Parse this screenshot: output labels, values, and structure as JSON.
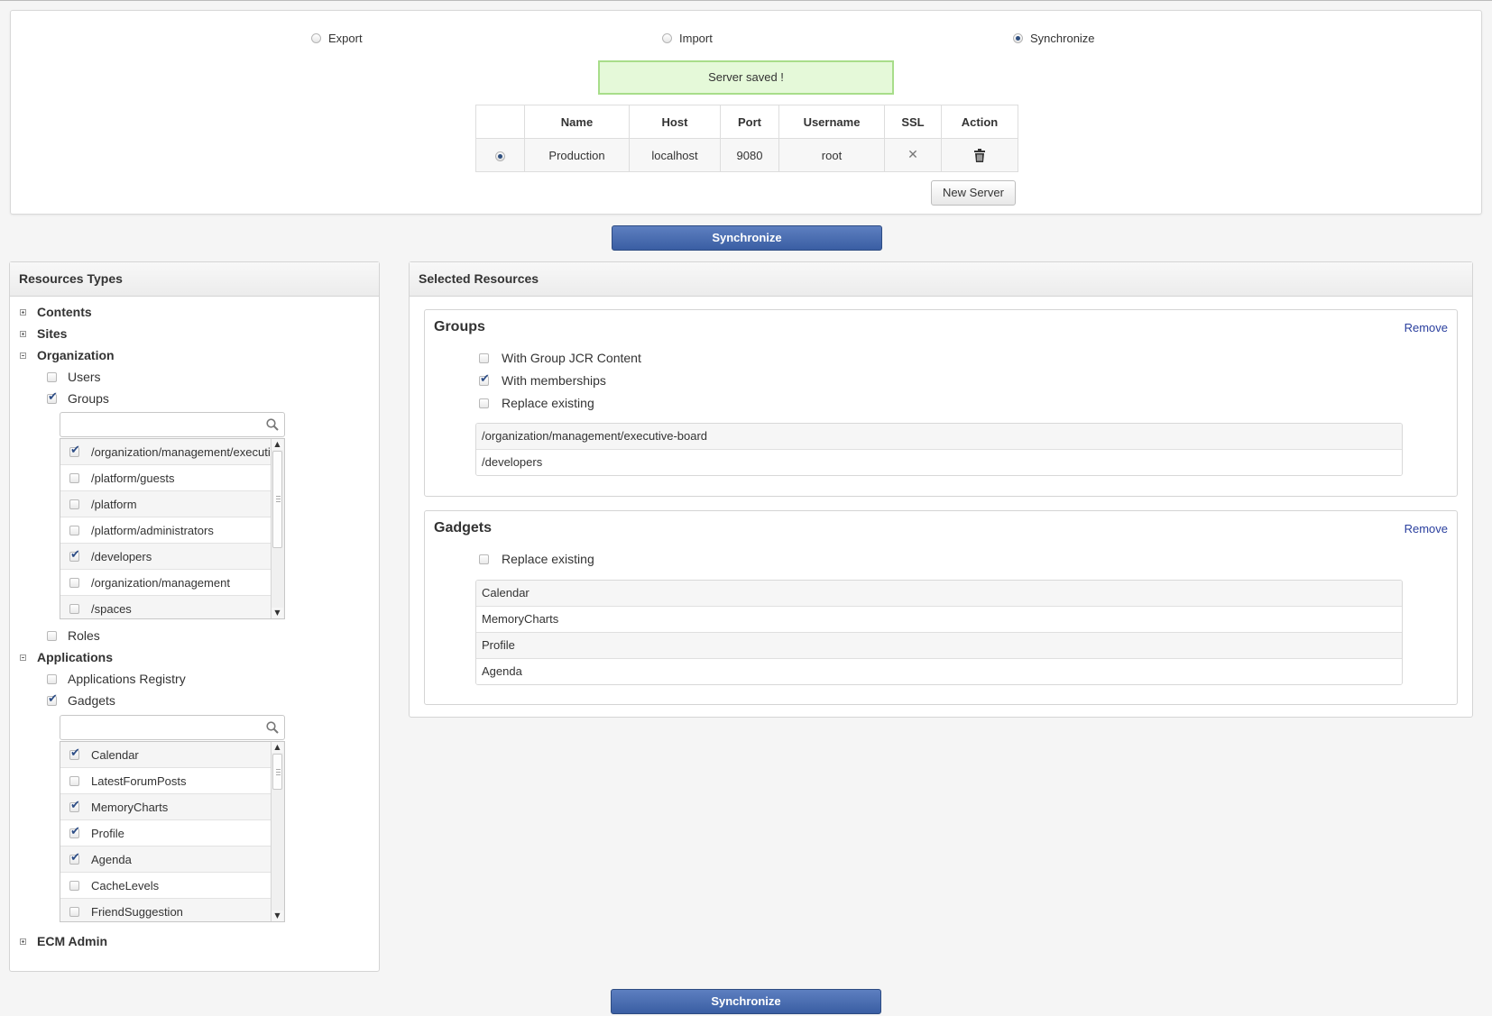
{
  "modes": [
    {
      "label": "Export",
      "selected": false
    },
    {
      "label": "Import",
      "selected": false
    },
    {
      "label": "Synchronize",
      "selected": true
    }
  ],
  "message": "Server saved !",
  "servers": {
    "headers": [
      "",
      "Name",
      "Host",
      "Port",
      "Username",
      "SSL",
      "Action"
    ],
    "rows": [
      {
        "name": "Production",
        "host": "localhost",
        "port": "9080",
        "username": "root",
        "ssl": "✕"
      }
    ]
  },
  "new_server_label": "New Server",
  "sync_label": "Synchronize",
  "resource_types": {
    "title": "Resources Types",
    "contents": "Contents",
    "sites": "Sites",
    "organization": "Organization",
    "users": "Users",
    "groups": "Groups",
    "roles": "Roles",
    "applications": "Applications",
    "applications_registry": "Applications Registry",
    "gadgets": "Gadgets",
    "ecm_admin": "ECM Admin",
    "group_search_placeholder": "",
    "gadget_search_placeholder": "",
    "group_list": [
      {
        "label": "/organization/management/executi",
        "checked": true
      },
      {
        "label": "/platform/guests",
        "checked": false
      },
      {
        "label": "/platform",
        "checked": false
      },
      {
        "label": "/platform/administrators",
        "checked": false
      },
      {
        "label": "/developers",
        "checked": true
      },
      {
        "label": "/organization/management",
        "checked": false
      },
      {
        "label": "/spaces",
        "checked": false
      }
    ],
    "gadget_list": [
      {
        "label": "Calendar",
        "checked": true
      },
      {
        "label": "LatestForumPosts",
        "checked": false
      },
      {
        "label": "MemoryCharts",
        "checked": true
      },
      {
        "label": "Profile",
        "checked": true
      },
      {
        "label": "Agenda",
        "checked": true
      },
      {
        "label": "CacheLevels",
        "checked": false
      },
      {
        "label": "FriendSuggestion",
        "checked": false
      }
    ]
  },
  "selected_resources": {
    "title": "Selected Resources",
    "groups": {
      "title": "Groups",
      "remove": "Remove",
      "options": [
        {
          "label": "With Group JCR Content",
          "checked": false
        },
        {
          "label": "With memberships",
          "checked": true
        },
        {
          "label": "Replace existing",
          "checked": false
        }
      ],
      "items": [
        "/organization/management/executive-board",
        "/developers"
      ]
    },
    "gadgets": {
      "title": "Gadgets",
      "remove": "Remove",
      "options": [
        {
          "label": "Replace existing",
          "checked": false
        }
      ],
      "items": [
        "Calendar",
        "MemoryCharts",
        "Profile",
        "Agenda"
      ]
    }
  },
  "icons": {
    "ssl": "close-icon",
    "action": "trash-icon",
    "search": "search-icon"
  }
}
